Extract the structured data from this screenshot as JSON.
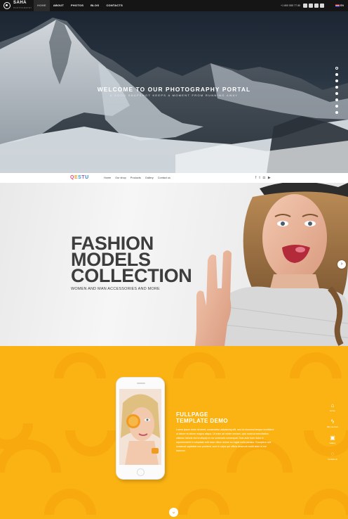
{
  "topbar": {
    "brand": "SAHA",
    "brand_sub": "PHOTOGRAPHY",
    "nav": [
      "HOME",
      "ABOUT",
      "PHOTOS",
      "BLOG",
      "CONTACTS"
    ],
    "phone": "+1 800 555 77 80",
    "social_icons": [
      "facebook-icon",
      "twitter-icon",
      "instagram-icon",
      "google-plus-icon"
    ],
    "lang": "EN"
  },
  "hero": {
    "title": "WELCOME TO OUR PHOTOGRAPHY PORTAL",
    "subtitle": "A GOOD SNAPSHOT KEEPS A MOMENT FROM RUNNING AWAY",
    "slide_dots": 8
  },
  "section2": {
    "logo_letters": [
      "Q",
      "E",
      "S",
      "T",
      "U"
    ],
    "nav": [
      "Home",
      "Our shop",
      "Products",
      "Gallery",
      "Contact us"
    ],
    "social_icons": [
      "facebook-icon",
      "twitter-icon",
      "instagram-icon",
      "youtube-icon"
    ],
    "headline": [
      "FASHION",
      "MODELS",
      "COLLECTION"
    ],
    "subheadline": "WOMEN AND MAN ACCESSORIES AND MORE",
    "next_arrow": "›"
  },
  "section3": {
    "title_line1": "FULLPAGE",
    "title_line2": "TEMPLATE DEMO",
    "body": "Lorem ipsum dolor sit amet, consectetur adipisicing elit, sed do eiusmod tempor incididunt ut labore et dolore magna aliqua. Ut enim ad minim veniam, quis nostrud exercitation ullamco laboris nisi ut aliquip ex ea commodo consequat. Duis aute irure dolor in reprehenderit in voluptate velit esse cillum dolore eu fugiat nulla pariatur. Excepteur sint occaecat cupidatat non proident, sunt in culpa qui officia deserunt mollit anim id est laborum.",
    "side_nav": [
      {
        "icon": "home-icon",
        "glyph": "⌂",
        "label": "Home"
      },
      {
        "icon": "lightning-icon",
        "glyph": "ϟ",
        "label": "Why we here"
      },
      {
        "icon": "gallery-icon",
        "glyph": "▣",
        "label": "Gallery"
      },
      {
        "icon": "chat-icon",
        "glyph": "◌",
        "label": "Contact us"
      }
    ],
    "down_arrow": "⌄"
  }
}
